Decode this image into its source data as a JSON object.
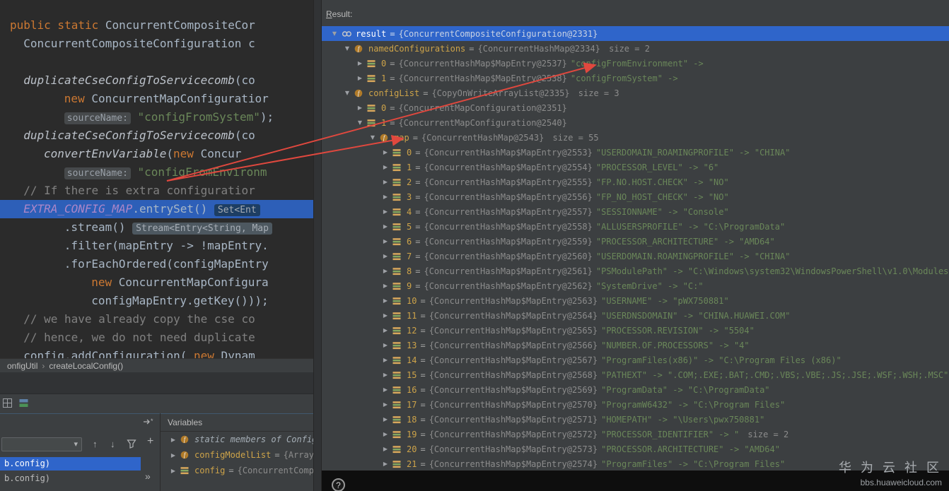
{
  "colors": {
    "editor_bg": "#2B2B2B",
    "panel_bg": "#3C3F41",
    "selection_blue": "#2F65CA",
    "editor_selection_blue": "#2D5FB8",
    "keyword_orange": "#CC7832",
    "name_orange": "#CDA349",
    "string_green": "#6A8759",
    "reference_gray": "#8C8C8C",
    "annotation_red": "#E0483E"
  },
  "icons": {
    "combo_arrow": "▾",
    "up_arrow": "↑",
    "down_arrow": "↓",
    "plus": "+",
    "more_chevrons": "»",
    "help": "?"
  },
  "editor": {
    "breadcrumb": {
      "left": "onfigUtil",
      "sep": "›",
      "right": "createLocalConfig()"
    },
    "lines": [
      {
        "indent": 0,
        "segs": [
          [
            "kw",
            "public static"
          ],
          [
            "pl",
            " ConcurrentCompositeCor"
          ]
        ]
      },
      {
        "indent": 2,
        "segs": [
          [
            "pl",
            "ConcurrentCompositeConfiguration c"
          ]
        ]
      },
      {
        "indent": 0,
        "segs": []
      },
      {
        "indent": 2,
        "segs": [
          [
            "mi",
            "duplicateCseConfigToServicecomb"
          ],
          [
            "pl",
            "(co"
          ]
        ]
      },
      {
        "indent": 8,
        "segs": [
          [
            "kw",
            "new"
          ],
          [
            "pl",
            " ConcurrentMapConfiguratior"
          ]
        ]
      },
      {
        "indent": 8,
        "segs": [
          [
            "hint",
            "sourceName:"
          ],
          [
            "pl",
            " "
          ],
          [
            "str",
            "\"configFromSystem\""
          ],
          [
            "pl",
            ");"
          ]
        ]
      },
      {
        "indent": 2,
        "segs": [
          [
            "mi",
            "duplicateCseConfigToServicecomb"
          ],
          [
            "pl",
            "(co"
          ]
        ]
      },
      {
        "indent": 5,
        "segs": [
          [
            "mi",
            "convertEnvVariable"
          ],
          [
            "pl",
            "("
          ],
          [
            "kw",
            "new"
          ],
          [
            "pl",
            " Concur"
          ]
        ]
      },
      {
        "indent": 8,
        "segs": [
          [
            "hint",
            "sourceName:"
          ],
          [
            "pl",
            " "
          ],
          [
            "str",
            "\"configFromEnvironm"
          ]
        ]
      },
      {
        "indent": 2,
        "segs": [
          [
            "cm",
            "// If there is extra configuratior"
          ]
        ]
      },
      {
        "indent": 2,
        "sel": true,
        "segs": [
          [
            "fld",
            "EXTRA_CONFIG_MAP"
          ],
          [
            "pl",
            ".entrySet() "
          ],
          [
            "chip",
            "Set<Ent"
          ]
        ]
      },
      {
        "indent": 8,
        "segs": [
          [
            "pl",
            ".stream() "
          ],
          [
            "chip",
            "Stream<Entry<String, Map"
          ]
        ]
      },
      {
        "indent": 8,
        "segs": [
          [
            "pl",
            ".filter(mapEntry -> !mapEntry."
          ]
        ]
      },
      {
        "indent": 8,
        "segs": [
          [
            "pl",
            ".forEachOrdered(configMapEntry"
          ]
        ]
      },
      {
        "indent": 12,
        "segs": [
          [
            "kw",
            "new"
          ],
          [
            "pl",
            " ConcurrentMapConfigura"
          ]
        ]
      },
      {
        "indent": 12,
        "segs": [
          [
            "pl",
            "configMapEntry.getKey()));"
          ]
        ]
      },
      {
        "indent": 2,
        "segs": [
          [
            "cm",
            "// we have already copy the cse co"
          ]
        ]
      },
      {
        "indent": 2,
        "segs": [
          [
            "cm",
            "// hence, we do not need duplicate"
          ]
        ]
      },
      {
        "indent": 2,
        "segs": [
          [
            "pl",
            "config.addConfiguration( "
          ],
          [
            "kw",
            "new"
          ],
          [
            "pl",
            " Dynam"
          ]
        ]
      }
    ]
  },
  "result_panel": {
    "label": "Result:",
    "rows": [
      {
        "d": 0,
        "x": "open",
        "i": "result",
        "n": "result",
        "r": "{ConcurrentCompositeConfiguration@2331}",
        "sel": true
      },
      {
        "d": 1,
        "x": "open",
        "i": "field",
        "n": "namedConfigurations",
        "r": "{ConcurrentHashMap@2334}",
        "s": " size = 2"
      },
      {
        "d": 2,
        "x": "closed",
        "i": "entry",
        "n": "0",
        "r": "{ConcurrentHashMap$MapEntry@2537}",
        "v": "\"configFromEnvironment\" ->"
      },
      {
        "d": 2,
        "x": "closed",
        "i": "entry",
        "n": "1",
        "r": "{ConcurrentHashMap$MapEntry@2538}",
        "v": "\"configFromSystem\" ->"
      },
      {
        "d": 1,
        "x": "open",
        "i": "field",
        "n": "configList",
        "r": "{CopyOnWriteArrayList@2335}",
        "s": " size = 3"
      },
      {
        "d": 2,
        "x": "closed",
        "i": "entry",
        "n": "0",
        "r": "{ConcurrentMapConfiguration@2351}"
      },
      {
        "d": 2,
        "x": "open",
        "i": "entry",
        "n": "1",
        "r": "{ConcurrentMapConfiguration@2540}"
      },
      {
        "d": 3,
        "x": "open",
        "i": "field",
        "n": "map",
        "r": "{ConcurrentHashMap@2543}",
        "s": " size = 55"
      },
      {
        "d": 4,
        "x": "closed",
        "i": "entry",
        "n": "0",
        "r": "{ConcurrentHashMap$MapEntry@2553}",
        "v": "\"USERDOMAIN_ROAMINGPROFILE\" -> \"CHINA\""
      },
      {
        "d": 4,
        "x": "closed",
        "i": "entry",
        "n": "1",
        "r": "{ConcurrentHashMap$MapEntry@2554}",
        "v": "\"PROCESSOR_LEVEL\" -> \"6\""
      },
      {
        "d": 4,
        "x": "closed",
        "i": "entry",
        "n": "2",
        "r": "{ConcurrentHashMap$MapEntry@2555}",
        "v": "\"FP.NO.HOST.CHECK\" -> \"NO\""
      },
      {
        "d": 4,
        "x": "closed",
        "i": "entry",
        "n": "3",
        "r": "{ConcurrentHashMap$MapEntry@2556}",
        "v": "\"FP_NO_HOST_CHECK\" -> \"NO\""
      },
      {
        "d": 4,
        "x": "closed",
        "i": "entry",
        "n": "4",
        "r": "{ConcurrentHashMap$MapEntry@2557}",
        "v": "\"SESSIONNAME\" -> \"Console\""
      },
      {
        "d": 4,
        "x": "closed",
        "i": "entry",
        "n": "5",
        "r": "{ConcurrentHashMap$MapEntry@2558}",
        "v": "\"ALLUSERSPROFILE\" -> \"C:\\ProgramData\""
      },
      {
        "d": 4,
        "x": "closed",
        "i": "entry",
        "n": "6",
        "r": "{ConcurrentHashMap$MapEntry@2559}",
        "v": "\"PROCESSOR_ARCHITECTURE\" -> \"AMD64\""
      },
      {
        "d": 4,
        "x": "closed",
        "i": "entry",
        "n": "7",
        "r": "{ConcurrentHashMap$MapEntry@2560}",
        "v": "\"USERDOMAIN.ROAMINGPROFILE\" -> \"CHINA\""
      },
      {
        "d": 4,
        "x": "closed",
        "i": "entry",
        "n": "8",
        "r": "{ConcurrentHashMap$MapEntry@2561}",
        "v": "\"PSModulePath\" -> \"C:\\Windows\\system32\\WindowsPowerShell\\v1.0\\Modules\\\""
      },
      {
        "d": 4,
        "x": "closed",
        "i": "entry",
        "n": "9",
        "r": "{ConcurrentHashMap$MapEntry@2562}",
        "v": "\"SystemDrive\" -> \"C:\""
      },
      {
        "d": 4,
        "x": "closed",
        "i": "entry",
        "n": "10",
        "r": "{ConcurrentHashMap$MapEntry@2563}",
        "v": "\"USERNAME\" -> \"pWX750881\""
      },
      {
        "d": 4,
        "x": "closed",
        "i": "entry",
        "n": "11",
        "r": "{ConcurrentHashMap$MapEntry@2564}",
        "v": "\"USERDNSDOMAIN\" -> \"CHINA.HUAWEI.COM\""
      },
      {
        "d": 4,
        "x": "closed",
        "i": "entry",
        "n": "12",
        "r": "{ConcurrentHashMap$MapEntry@2565}",
        "v": "\"PROCESSOR.REVISION\" -> \"5504\""
      },
      {
        "d": 4,
        "x": "closed",
        "i": "entry",
        "n": "13",
        "r": "{ConcurrentHashMap$MapEntry@2566}",
        "v": "\"NUMBER.OF.PROCESSORS\" -> \"4\""
      },
      {
        "d": 4,
        "x": "closed",
        "i": "entry",
        "n": "14",
        "r": "{ConcurrentHashMap$MapEntry@2567}",
        "v": "\"ProgramFiles(x86)\" -> \"C:\\Program Files (x86)\""
      },
      {
        "d": 4,
        "x": "closed",
        "i": "entry",
        "n": "15",
        "r": "{ConcurrentHashMap$MapEntry@2568}",
        "v": "\"PATHEXT\" -> \".COM;.EXE;.BAT;.CMD;.VBS;.VBE;.JS;.JSE;.WSF;.WSH;.MSC\""
      },
      {
        "d": 4,
        "x": "closed",
        "i": "entry",
        "n": "16",
        "r": "{ConcurrentHashMap$MapEntry@2569}",
        "v": "\"ProgramData\" -> \"C:\\ProgramData\""
      },
      {
        "d": 4,
        "x": "closed",
        "i": "entry",
        "n": "17",
        "r": "{ConcurrentHashMap$MapEntry@2570}",
        "v": "\"ProgramW6432\" -> \"C:\\Program Files\""
      },
      {
        "d": 4,
        "x": "closed",
        "i": "entry",
        "n": "18",
        "r": "{ConcurrentHashMap$MapEntry@2571}",
        "v": "\"HOMEPATH\" -> \"\\Users\\pwx750881\""
      },
      {
        "d": 4,
        "x": "closed",
        "i": "entry",
        "n": "19",
        "r": "{ConcurrentHashMap$MapEntry@2572}",
        "v": "\"PROCESSOR_IDENTIFIER\" -> \"",
        "s": " size = 2"
      },
      {
        "d": 4,
        "x": "closed",
        "i": "entry",
        "n": "20",
        "r": "{ConcurrentHashMap$MapEntry@2573}",
        "v": "\"PROCESSOR.ARCHITECTURE\" -> \"AMD64\""
      },
      {
        "d": 4,
        "x": "closed",
        "i": "entry",
        "n": "21",
        "r": "{ConcurrentHashMap$MapEntry@2574}",
        "v": "\"ProgramFiles\" -> \"C:\\Program Files\""
      }
    ]
  },
  "debug_panel": {
    "variables_tab": "Variables",
    "variables_rows": [
      {
        "x": "closed",
        "i": "field",
        "lbl": "static members of ConfigUtil"
      },
      {
        "x": "closed",
        "i": "field",
        "n": "configModelList",
        "r": "{ArrayList@"
      },
      {
        "x": "closed",
        "i": "entry",
        "n": "config",
        "r": "{ConcurrentComposi"
      }
    ],
    "frames": [
      {
        "label": "b.config)",
        "sel": true
      },
      {
        "label": "b.config)",
        "sel": false
      }
    ]
  },
  "watermark": {
    "title": "华 为 云 社 区",
    "url": "bbs.huaweicloud.com"
  }
}
